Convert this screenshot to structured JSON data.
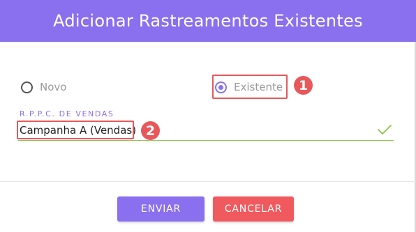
{
  "dialog": {
    "title": "Adicionar Rastreamentos Existentes"
  },
  "options": {
    "novo_label": "Novo",
    "existente_label": "Existente",
    "selected": "Existente"
  },
  "field": {
    "label": "R.P.P.C. DE VENDAS",
    "value": "Campanha A (Vendas)",
    "valid": true
  },
  "annotations": {
    "marker1": "1",
    "marker2": "2"
  },
  "actions": {
    "submit_label": "ENVIAR",
    "cancel_label": "CANCELAR"
  },
  "colors": {
    "primary": "#8a6fef",
    "danger": "#f0595e",
    "highlight": "#e8585b",
    "valid": "#8bc34a"
  },
  "icons": {
    "valid": "check-icon"
  }
}
